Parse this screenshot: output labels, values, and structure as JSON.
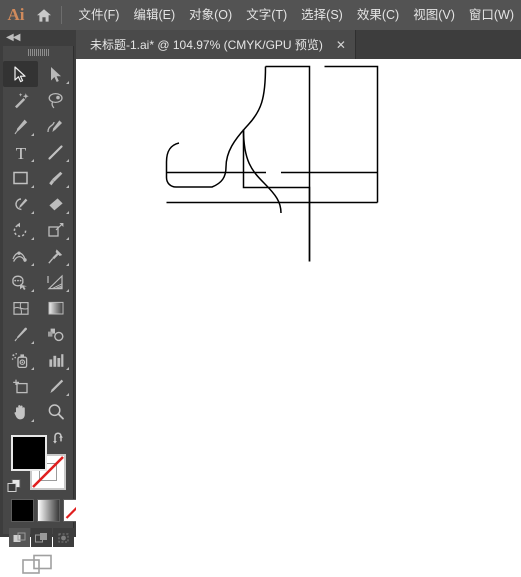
{
  "app": {
    "name": "Ai",
    "home_icon": "home-icon"
  },
  "menubar": {
    "items": [
      {
        "label": "文件(F)",
        "name": "menu-file"
      },
      {
        "label": "编辑(E)",
        "name": "menu-edit"
      },
      {
        "label": "对象(O)",
        "name": "menu-object"
      },
      {
        "label": "文字(T)",
        "name": "menu-type"
      },
      {
        "label": "选择(S)",
        "name": "menu-select"
      },
      {
        "label": "效果(C)",
        "name": "menu-effect"
      },
      {
        "label": "视图(V)",
        "name": "menu-view"
      },
      {
        "label": "窗口(W)",
        "name": "menu-window"
      }
    ],
    "background_color": "#535353",
    "logo_color": "#d08a5c"
  },
  "tabstrip": {
    "document_tab": {
      "title": "未标题-1.ai* @ 104.97% (CMYK/GPU 预览)",
      "close_label": "✕",
      "modified": true,
      "zoom_percent": "104.97%",
      "color_mode": "CMYK",
      "preview_mode": "GPU 预览"
    }
  },
  "toolbar": {
    "collapse_label": "◀◀",
    "tools": [
      {
        "name": "selection-tool",
        "icon": "arrow-solid-icon",
        "active": true,
        "has_flyout": false
      },
      {
        "name": "direct-selection-tool",
        "icon": "arrow-filled-icon",
        "active": false,
        "has_flyout": true
      },
      {
        "name": "magic-wand-tool",
        "icon": "magic-wand-icon",
        "active": false,
        "has_flyout": false
      },
      {
        "name": "lasso-tool",
        "icon": "lasso-icon",
        "active": false,
        "has_flyout": false
      },
      {
        "name": "pen-tool",
        "icon": "pen-icon",
        "active": false,
        "has_flyout": true
      },
      {
        "name": "curvature-tool",
        "icon": "curvature-icon",
        "active": false,
        "has_flyout": false
      },
      {
        "name": "type-tool",
        "icon": "type-t-icon",
        "active": false,
        "has_flyout": true
      },
      {
        "name": "line-segment-tool",
        "icon": "line-diagonal-icon",
        "active": false,
        "has_flyout": true
      },
      {
        "name": "rectangle-tool",
        "icon": "rectangle-icon",
        "active": false,
        "has_flyout": true
      },
      {
        "name": "paintbrush-tool",
        "icon": "paintbrush-icon",
        "active": false,
        "has_flyout": true
      },
      {
        "name": "shaper-tool",
        "icon": "shaper-pencil-icon",
        "active": false,
        "has_flyout": true
      },
      {
        "name": "eraser-tool",
        "icon": "eraser-icon",
        "active": false,
        "has_flyout": true
      },
      {
        "name": "rotate-tool",
        "icon": "rotate-icon",
        "active": false,
        "has_flyout": true
      },
      {
        "name": "scale-tool",
        "icon": "scale-icon",
        "active": false,
        "has_flyout": true
      },
      {
        "name": "width-tool",
        "icon": "width-warp-icon",
        "active": false,
        "has_flyout": true
      },
      {
        "name": "free-transform-tool",
        "icon": "pushpin-icon",
        "active": false,
        "has_flyout": true
      },
      {
        "name": "shape-builder-tool",
        "icon": "shape-builder-icon",
        "active": false,
        "has_flyout": true
      },
      {
        "name": "perspective-grid-tool",
        "icon": "perspective-grid-icon",
        "active": false,
        "has_flyout": true
      },
      {
        "name": "mesh-tool",
        "icon": "mesh-icon",
        "active": false,
        "has_flyout": false
      },
      {
        "name": "gradient-tool",
        "icon": "gradient-icon",
        "active": false,
        "has_flyout": false
      },
      {
        "name": "eyedropper-tool",
        "icon": "eyedropper-icon",
        "active": false,
        "has_flyout": true
      },
      {
        "name": "blend-tool",
        "icon": "blend-icon",
        "active": false,
        "has_flyout": false
      },
      {
        "name": "symbol-sprayer-tool",
        "icon": "symbol-sprayer-icon",
        "active": false,
        "has_flyout": true
      },
      {
        "name": "column-graph-tool",
        "icon": "bar-chart-icon",
        "active": false,
        "has_flyout": true
      },
      {
        "name": "artboard-tool",
        "icon": "artboard-icon",
        "active": false,
        "has_flyout": false
      },
      {
        "name": "slice-tool",
        "icon": "slice-knife-icon",
        "active": false,
        "has_flyout": true
      },
      {
        "name": "hand-tool",
        "icon": "hand-icon",
        "active": false,
        "has_flyout": true
      },
      {
        "name": "zoom-tool",
        "icon": "magnifier-icon",
        "active": false,
        "has_flyout": false
      }
    ],
    "color_controls": {
      "fill_color": "#000000",
      "stroke_color": "none",
      "swap_icon": "swap-arrow-icon",
      "default_icon": "default-colors-icon",
      "modes": [
        {
          "name": "color-mode-button",
          "icon": "solid-color-icon",
          "selected": true
        },
        {
          "name": "gradient-mode-button",
          "icon": "gradient-swatch-icon",
          "selected": false
        },
        {
          "name": "none-mode-button",
          "icon": "none-swatch-icon",
          "selected": false
        }
      ],
      "draw_modes": [
        {
          "name": "draw-normal-button",
          "icon": "draw-normal-icon",
          "selected": true
        },
        {
          "name": "draw-behind-button",
          "icon": "draw-behind-icon",
          "selected": false
        },
        {
          "name": "draw-inside-button",
          "icon": "draw-inside-icon",
          "selected": false
        }
      ],
      "screen_mode": {
        "name": "change-screen-mode-button",
        "icon": "screen-mode-icon"
      }
    }
  },
  "canvas": {
    "background_color": "#ffffff",
    "artwork": {
      "name": "boot-outline-path",
      "stroke_color": "#000000",
      "fill_color": "none",
      "stroke_width": 1.4,
      "description": "boot / sock shaped outline with S-curve and sole line"
    }
  }
}
